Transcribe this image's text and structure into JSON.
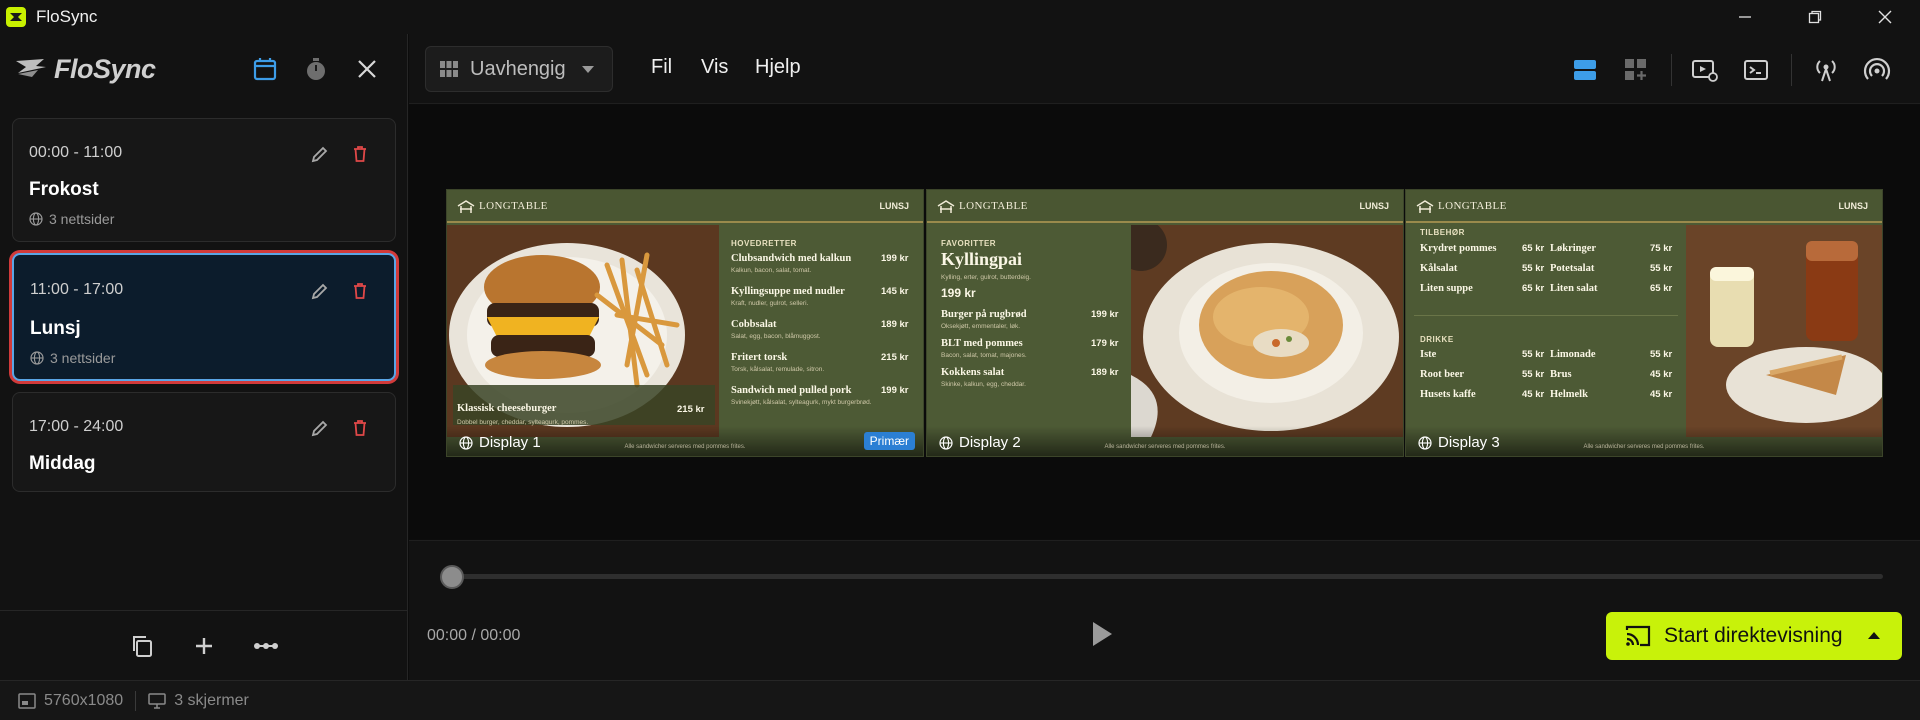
{
  "window": {
    "title": "FloSync"
  },
  "sidebar": {
    "brand": "FloSync",
    "schedules": [
      {
        "time": "00:00 - 11:00",
        "name": "Frokost",
        "meta": "3 nettsider"
      },
      {
        "time": "11:00 - 17:00",
        "name": "Lunsj",
        "meta": "3 nettsider"
      },
      {
        "time": "17:00 - 24:00",
        "name": "Middag"
      }
    ]
  },
  "toolbar": {
    "layout": "Uavhengig",
    "menu": {
      "file": "Fil",
      "view": "Vis",
      "help": "Hjelp"
    }
  },
  "displays": [
    {
      "label": "Display 1",
      "brand": "LONGTABLE",
      "tag": "LUNSJ",
      "badge": "Primær",
      "section": "HOVEDRETTER",
      "feature": {
        "name": "Klassisk cheeseburger",
        "price": "215 kr",
        "desc": "Dobbel burger, cheddar, sylteagurk, pommes."
      },
      "items": [
        {
          "name": "Clubsandwich med kalkun",
          "price": "199 kr",
          "desc": "Kalkun, bacon, salat, tomat."
        },
        {
          "name": "Kyllingsuppe med nudler",
          "price": "145 kr",
          "desc": "Kraft, nudler, gulrot, selleri."
        },
        {
          "name": "Cobbsalat",
          "price": "189 kr",
          "desc": "Salat, egg, bacon, blåmuggost."
        },
        {
          "name": "Fritert torsk",
          "price": "215 kr",
          "desc": "Torsk, kålsalat, remulade, sitron."
        },
        {
          "name": "Sandwich med pulled pork",
          "price": "199 kr",
          "desc": "Svinekjøtt, kålsalat, sylteagurk, mykt burgerbrød."
        }
      ],
      "footnote": "Alle sandwicher serveres med pommes frites."
    },
    {
      "label": "Display 2",
      "brand": "LONGTABLE",
      "tag": "LUNSJ",
      "section": "FAVORITTER",
      "hero": {
        "name": "Kyllingpai",
        "desc": "Kylling, erter, gulrot, butterdeig.",
        "price": "199 kr"
      },
      "items": [
        {
          "name": "Burger på rugbrød",
          "price": "199 kr",
          "desc": "Oksekjøtt, emmentaler, løk."
        },
        {
          "name": "BLT med pommes",
          "price": "179 kr",
          "desc": "Bacon, salat, tomat, majones."
        },
        {
          "name": "Kokkens salat",
          "price": "189 kr",
          "desc": "Skinke, kalkun, egg, cheddar."
        }
      ],
      "footnote": "Alle sandwicher serveres med pommes frites."
    },
    {
      "label": "Display 3",
      "brand": "LONGTABLE",
      "tag": "LUNSJ",
      "sides_title": "TILBEHØR",
      "sides": [
        {
          "name": "Krydret pommes",
          "price": "65 kr"
        },
        {
          "name": "Løkringer",
          "price": "75 kr"
        },
        {
          "name": "Kålsalat",
          "price": "55 kr"
        },
        {
          "name": "Potetsalat",
          "price": "55 kr"
        },
        {
          "name": "Liten suppe",
          "price": "65 kr"
        },
        {
          "name": "Liten salat",
          "price": "65 kr"
        }
      ],
      "drinks_title": "DRIKKE",
      "drinks": [
        {
          "name": "Iste",
          "price": "55 kr"
        },
        {
          "name": "Limonade",
          "price": "55 kr"
        },
        {
          "name": "Root beer",
          "price": "55 kr"
        },
        {
          "name": "Brus",
          "price": "45 kr"
        },
        {
          "name": "Husets kaffe",
          "price": "45 kr"
        },
        {
          "name": "Helmelk",
          "price": "45 kr"
        }
      ],
      "footnote": "Alle sandwicher serveres med pommes frites."
    }
  ],
  "player": {
    "time": "00:00 / 00:00",
    "live_label": "Start direktevisning",
    "progress": 0
  },
  "status": {
    "resolution": "5760x1080",
    "screens": "3 skjermer"
  },
  "colors": {
    "accent": "#c8f20a",
    "selection": "#5aa5e6",
    "danger": "#e04848",
    "primary_badge": "#2b7fd4"
  }
}
